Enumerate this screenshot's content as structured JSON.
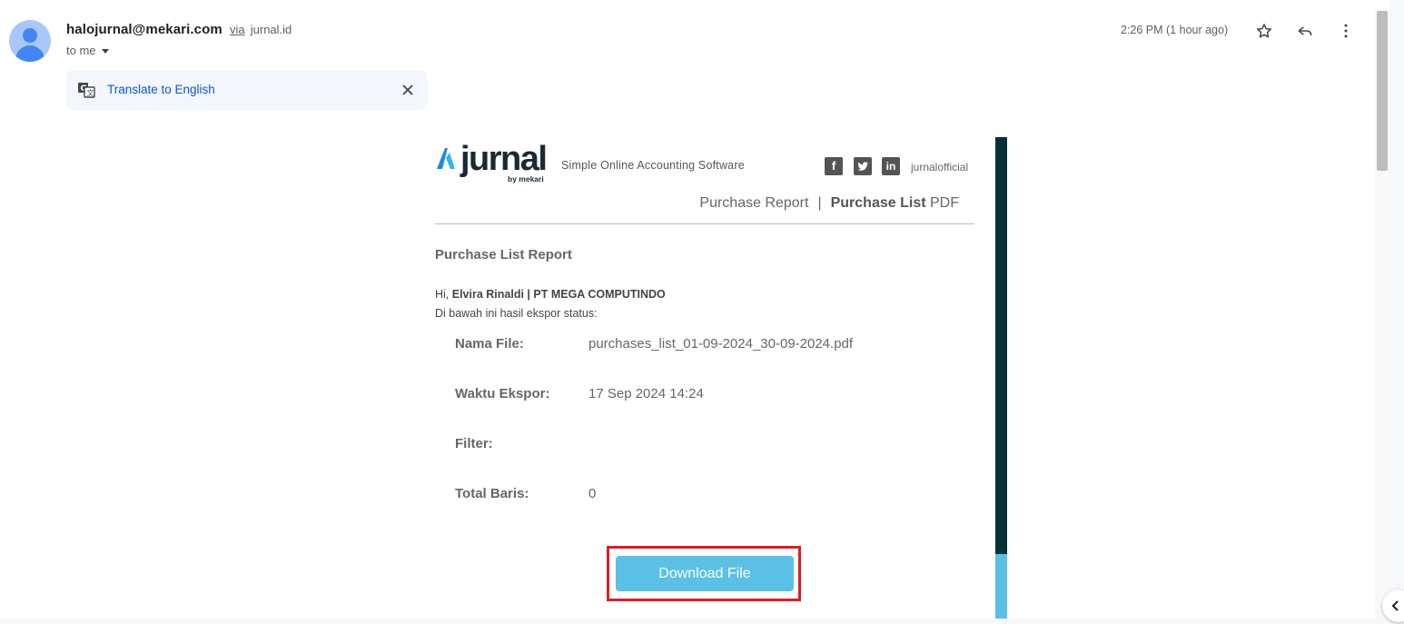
{
  "header": {
    "sender_email": "halojurnal@mekari.com",
    "via_label": "via",
    "via_domain": "jurnal.id",
    "recipient_label": "to me",
    "timestamp": "2:26 PM (1 hour ago)"
  },
  "translate": {
    "label": "Translate to English"
  },
  "email": {
    "logo_text": "jurnal",
    "logo_sub": "by mekari",
    "tagline": "Simple Online Accounting Software",
    "social_handle": "jurnalofficial",
    "report_link_1": "Purchase Report",
    "separator": "|",
    "report_link_2_bold": "Purchase List",
    "report_link_2_suffix": " PDF",
    "title": "Purchase List Report",
    "greeting_prefix": "Hi, ",
    "greeting_name": "Elvira Rinaldi | PT MEGA COMPUTINDO",
    "intro": "Di bawah ini hasil ekspor status:",
    "details": [
      {
        "label": "Nama File:",
        "value": "purchases_list_01-09-2024_30-09-2024.pdf"
      },
      {
        "label": "Waktu Ekspor:",
        "value": "17 Sep 2024 14:24"
      },
      {
        "label": "Filter:",
        "value": ""
      },
      {
        "label": "Total Baris:",
        "value": "0"
      }
    ],
    "download_label": "Download File"
  },
  "colors": {
    "accent_dark": "#03303a",
    "accent_light": "#5bc0e6",
    "highlight": "#e01b24",
    "link_blue": "#0b57d0"
  },
  "icons": {
    "star": "star-icon",
    "reply": "reply-icon",
    "more": "more-vert-icon",
    "translate": "translate-icon",
    "close": "close-icon",
    "facebook": "facebook-icon",
    "twitter": "twitter-icon",
    "linkedin": "linkedin-icon"
  }
}
